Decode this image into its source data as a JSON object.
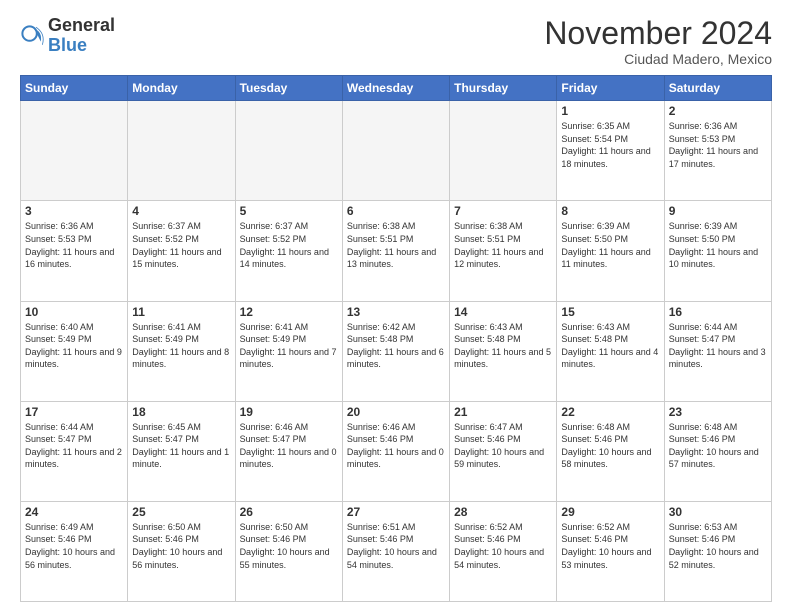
{
  "logo": {
    "general": "General",
    "blue": "Blue"
  },
  "header": {
    "month": "November 2024",
    "location": "Ciudad Madero, Mexico"
  },
  "days_of_week": [
    "Sunday",
    "Monday",
    "Tuesday",
    "Wednesday",
    "Thursday",
    "Friday",
    "Saturday"
  ],
  "weeks": [
    [
      {
        "day": "",
        "info": ""
      },
      {
        "day": "",
        "info": ""
      },
      {
        "day": "",
        "info": ""
      },
      {
        "day": "",
        "info": ""
      },
      {
        "day": "",
        "info": ""
      },
      {
        "day": "1",
        "info": "Sunrise: 6:35 AM\nSunset: 5:54 PM\nDaylight: 11 hours and 18 minutes."
      },
      {
        "day": "2",
        "info": "Sunrise: 6:36 AM\nSunset: 5:53 PM\nDaylight: 11 hours and 17 minutes."
      }
    ],
    [
      {
        "day": "3",
        "info": "Sunrise: 6:36 AM\nSunset: 5:53 PM\nDaylight: 11 hours and 16 minutes."
      },
      {
        "day": "4",
        "info": "Sunrise: 6:37 AM\nSunset: 5:52 PM\nDaylight: 11 hours and 15 minutes."
      },
      {
        "day": "5",
        "info": "Sunrise: 6:37 AM\nSunset: 5:52 PM\nDaylight: 11 hours and 14 minutes."
      },
      {
        "day": "6",
        "info": "Sunrise: 6:38 AM\nSunset: 5:51 PM\nDaylight: 11 hours and 13 minutes."
      },
      {
        "day": "7",
        "info": "Sunrise: 6:38 AM\nSunset: 5:51 PM\nDaylight: 11 hours and 12 minutes."
      },
      {
        "day": "8",
        "info": "Sunrise: 6:39 AM\nSunset: 5:50 PM\nDaylight: 11 hours and 11 minutes."
      },
      {
        "day": "9",
        "info": "Sunrise: 6:39 AM\nSunset: 5:50 PM\nDaylight: 11 hours and 10 minutes."
      }
    ],
    [
      {
        "day": "10",
        "info": "Sunrise: 6:40 AM\nSunset: 5:49 PM\nDaylight: 11 hours and 9 minutes."
      },
      {
        "day": "11",
        "info": "Sunrise: 6:41 AM\nSunset: 5:49 PM\nDaylight: 11 hours and 8 minutes."
      },
      {
        "day": "12",
        "info": "Sunrise: 6:41 AM\nSunset: 5:49 PM\nDaylight: 11 hours and 7 minutes."
      },
      {
        "day": "13",
        "info": "Sunrise: 6:42 AM\nSunset: 5:48 PM\nDaylight: 11 hours and 6 minutes."
      },
      {
        "day": "14",
        "info": "Sunrise: 6:43 AM\nSunset: 5:48 PM\nDaylight: 11 hours and 5 minutes."
      },
      {
        "day": "15",
        "info": "Sunrise: 6:43 AM\nSunset: 5:48 PM\nDaylight: 11 hours and 4 minutes."
      },
      {
        "day": "16",
        "info": "Sunrise: 6:44 AM\nSunset: 5:47 PM\nDaylight: 11 hours and 3 minutes."
      }
    ],
    [
      {
        "day": "17",
        "info": "Sunrise: 6:44 AM\nSunset: 5:47 PM\nDaylight: 11 hours and 2 minutes."
      },
      {
        "day": "18",
        "info": "Sunrise: 6:45 AM\nSunset: 5:47 PM\nDaylight: 11 hours and 1 minute."
      },
      {
        "day": "19",
        "info": "Sunrise: 6:46 AM\nSunset: 5:47 PM\nDaylight: 11 hours and 0 minutes."
      },
      {
        "day": "20",
        "info": "Sunrise: 6:46 AM\nSunset: 5:46 PM\nDaylight: 11 hours and 0 minutes."
      },
      {
        "day": "21",
        "info": "Sunrise: 6:47 AM\nSunset: 5:46 PM\nDaylight: 10 hours and 59 minutes."
      },
      {
        "day": "22",
        "info": "Sunrise: 6:48 AM\nSunset: 5:46 PM\nDaylight: 10 hours and 58 minutes."
      },
      {
        "day": "23",
        "info": "Sunrise: 6:48 AM\nSunset: 5:46 PM\nDaylight: 10 hours and 57 minutes."
      }
    ],
    [
      {
        "day": "24",
        "info": "Sunrise: 6:49 AM\nSunset: 5:46 PM\nDaylight: 10 hours and 56 minutes."
      },
      {
        "day": "25",
        "info": "Sunrise: 6:50 AM\nSunset: 5:46 PM\nDaylight: 10 hours and 56 minutes."
      },
      {
        "day": "26",
        "info": "Sunrise: 6:50 AM\nSunset: 5:46 PM\nDaylight: 10 hours and 55 minutes."
      },
      {
        "day": "27",
        "info": "Sunrise: 6:51 AM\nSunset: 5:46 PM\nDaylight: 10 hours and 54 minutes."
      },
      {
        "day": "28",
        "info": "Sunrise: 6:52 AM\nSunset: 5:46 PM\nDaylight: 10 hours and 54 minutes."
      },
      {
        "day": "29",
        "info": "Sunrise: 6:52 AM\nSunset: 5:46 PM\nDaylight: 10 hours and 53 minutes."
      },
      {
        "day": "30",
        "info": "Sunrise: 6:53 AM\nSunset: 5:46 PM\nDaylight: 10 hours and 52 minutes."
      }
    ]
  ]
}
